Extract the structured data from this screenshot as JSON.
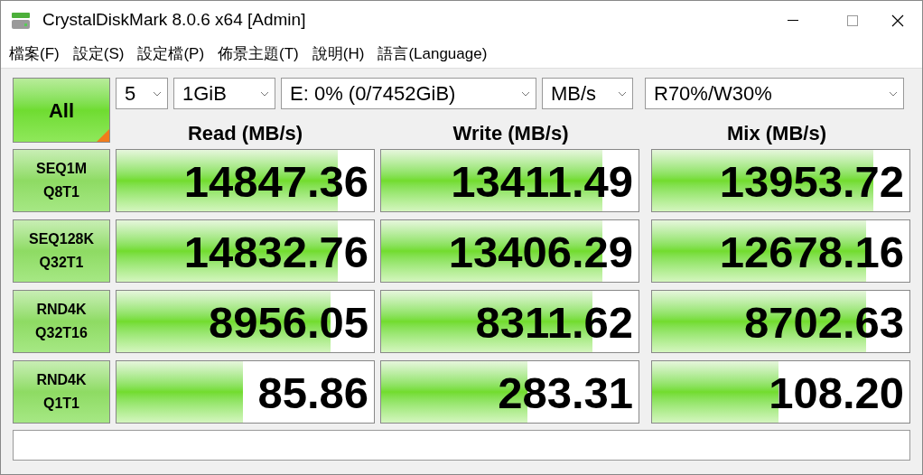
{
  "window": {
    "title": "CrystalDiskMark 8.0.6 x64 [Admin]"
  },
  "menu": [
    "檔案(F)",
    "設定(S)",
    "設定檔(P)",
    "佈景主題(T)",
    "說明(H)",
    "語言(Language)"
  ],
  "all_button": "All",
  "selects": [
    {
      "value": "5"
    },
    {
      "value": "1GiB"
    },
    {
      "value": "E: 0% (0/7452GiB)"
    },
    {
      "value": "MB/s"
    },
    {
      "value": "R70%/W30%"
    }
  ],
  "columns": [
    "Read (MB/s)",
    "Write (MB/s)",
    "Mix (MB/s)"
  ],
  "rows": [
    {
      "test": [
        "SEQ1M",
        "Q8T1"
      ],
      "results": [
        {
          "value": "14847.36",
          "level": 0.86
        },
        {
          "value": "13411.49",
          "level": 0.86
        },
        {
          "value": "13953.72",
          "level": 0.86
        }
      ]
    },
    {
      "test": [
        "SEQ128K",
        "Q32T1"
      ],
      "results": [
        {
          "value": "14832.76",
          "level": 0.86
        },
        {
          "value": "13406.29",
          "level": 0.86
        },
        {
          "value": "12678.16",
          "level": 0.83
        }
      ]
    },
    {
      "test": [
        "RND4K",
        "Q32T16"
      ],
      "results": [
        {
          "value": "8956.05",
          "level": 0.83
        },
        {
          "value": "8311.62",
          "level": 0.82
        },
        {
          "value": "8702.63",
          "level": 0.83
        }
      ]
    },
    {
      "test": [
        "RND4K",
        "Q1T1"
      ],
      "results": [
        {
          "value": "85.86",
          "level": 0.49
        },
        {
          "value": "283.31",
          "level": 0.57
        },
        {
          "value": "108.20",
          "level": 0.49
        }
      ]
    }
  ]
}
